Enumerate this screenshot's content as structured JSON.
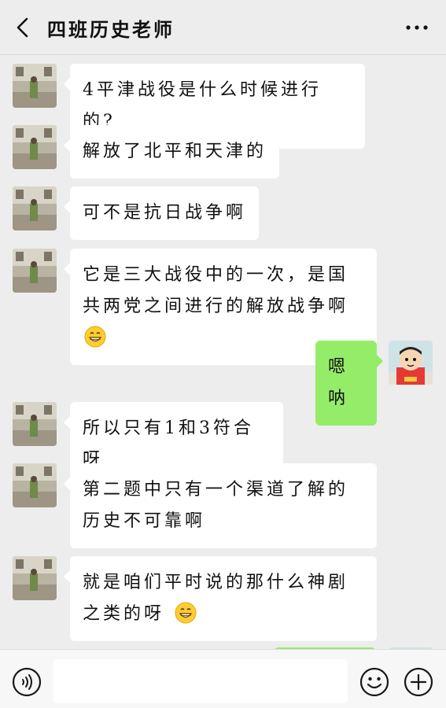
{
  "header": {
    "title": "四班历史老师"
  },
  "messages": [
    {
      "side": "left",
      "text": "4平津战役是什么时候进行的?",
      "emoji": null
    },
    {
      "side": "left",
      "text": "解放了北平和天津的",
      "emoji": null
    },
    {
      "side": "left",
      "text": "可不是抗日战争啊",
      "emoji": null
    },
    {
      "side": "left",
      "text": "它是三大战役中的一次，是国共两党之间进行的解放战争啊",
      "emoji": "grin-emoji"
    },
    {
      "side": "right",
      "text": "嗯呐",
      "emoji": null
    },
    {
      "side": "left",
      "text": "所以只有1和3符合呀",
      "emoji": null
    },
    {
      "side": "left",
      "text": "第二题中只有一个渠道了解的历史不可靠啊",
      "emoji": null
    },
    {
      "side": "left",
      "text": "就是咱们平时说的那什么神剧之类的呀",
      "emoji": "grin-emoji"
    }
  ],
  "icons": {
    "back": "chevron-left-icon",
    "more": "more-dots-icon",
    "voice": "voice-icon",
    "emoji": "smiley-icon",
    "plus": "plus-icon"
  },
  "colors": {
    "bg": "#ededed",
    "bubble_left": "#ffffff",
    "bubble_right": "#95ec69"
  }
}
